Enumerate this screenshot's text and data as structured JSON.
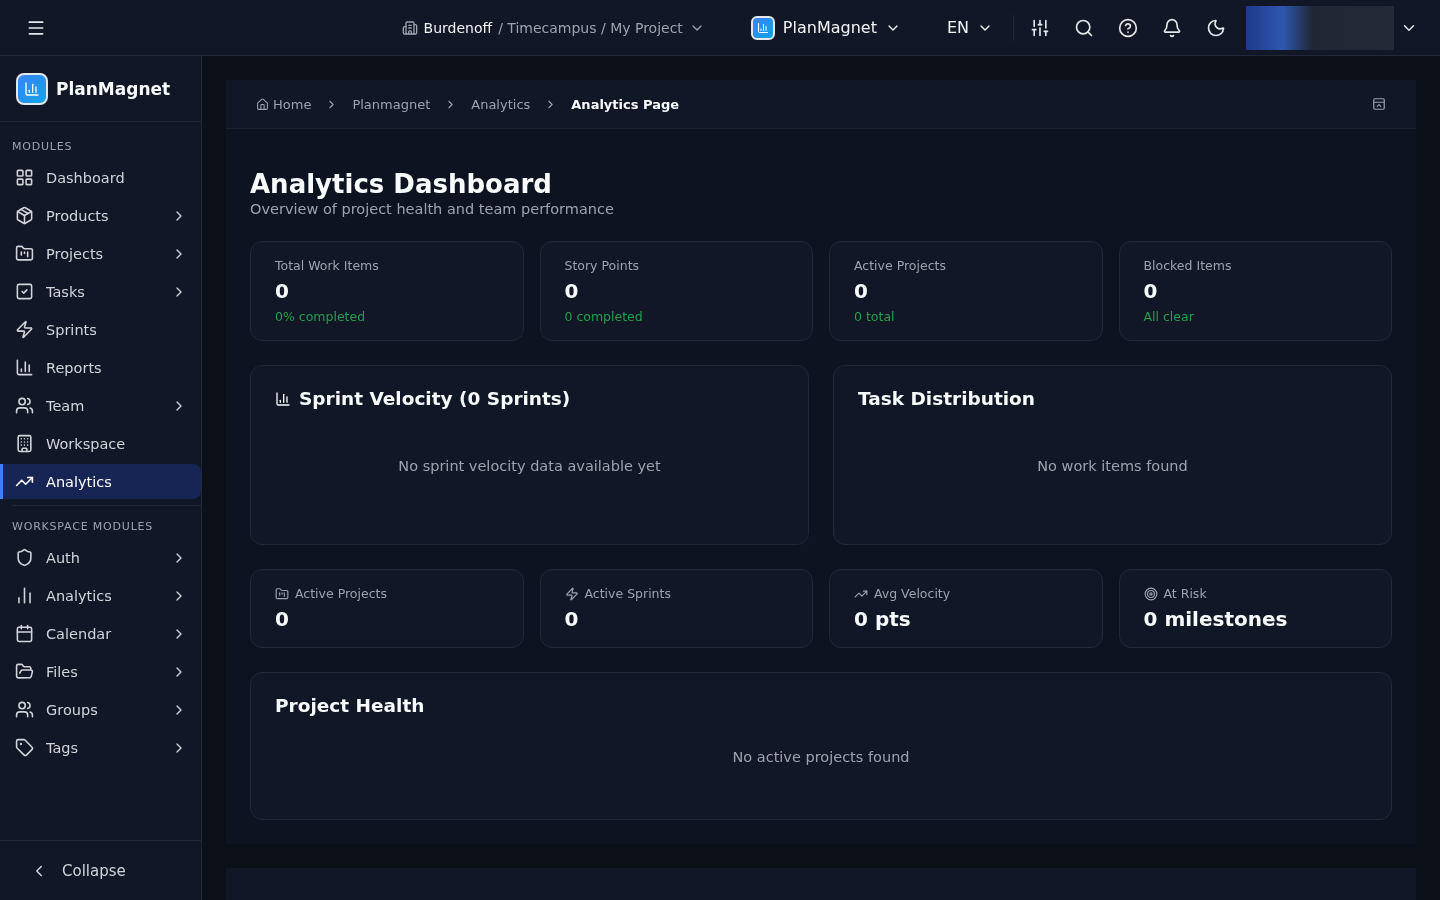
{
  "topbar": {
    "org": "Burdenoff",
    "path": "/ Timecampus / My Project",
    "app": "PlanMagnet",
    "language": "EN"
  },
  "sidebar": {
    "brand": "PlanMagnet",
    "sections": [
      {
        "title": "MODULES",
        "items": [
          {
            "label": "Dashboard",
            "expandable": false,
            "selected": false
          },
          {
            "label": "Products",
            "expandable": true,
            "selected": false
          },
          {
            "label": "Projects",
            "expandable": true,
            "selected": false
          },
          {
            "label": "Tasks",
            "expandable": true,
            "selected": false
          },
          {
            "label": "Sprints",
            "expandable": false,
            "selected": false
          },
          {
            "label": "Reports",
            "expandable": false,
            "selected": false
          },
          {
            "label": "Team",
            "expandable": true,
            "selected": false
          },
          {
            "label": "Workspace",
            "expandable": false,
            "selected": false
          },
          {
            "label": "Analytics",
            "expandable": false,
            "selected": true
          }
        ]
      },
      {
        "title": "WORKSPACE MODULES",
        "items": [
          {
            "label": "Auth",
            "expandable": true,
            "selected": false
          },
          {
            "label": "Analytics",
            "expandable": true,
            "selected": false
          },
          {
            "label": "Calendar",
            "expandable": true,
            "selected": false
          },
          {
            "label": "Files",
            "expandable": true,
            "selected": false
          },
          {
            "label": "Groups",
            "expandable": true,
            "selected": false
          },
          {
            "label": "Tags",
            "expandable": true,
            "selected": false
          }
        ]
      }
    ],
    "collapse": "Collapse"
  },
  "breadcrumb": [
    "Home",
    "Planmagnet",
    "Analytics",
    "Analytics Page"
  ],
  "page": {
    "title": "Analytics Dashboard",
    "subtitle": "Overview of project health and team performance"
  },
  "stats": [
    {
      "label": "Total Work Items",
      "value": "0",
      "note": "0% completed"
    },
    {
      "label": "Story Points",
      "value": "0",
      "note": "0 completed"
    },
    {
      "label": "Active Projects",
      "value": "0",
      "note": "0 total"
    },
    {
      "label": "Blocked Items",
      "value": "0",
      "note": "All clear"
    }
  ],
  "panels": [
    {
      "title": "Sprint Velocity (0 Sprints)",
      "icon": true,
      "empty": "No sprint velocity data available yet"
    },
    {
      "title": "Task Distribution",
      "icon": false,
      "empty": "No work items found"
    }
  ],
  "metrics": [
    {
      "label": "Active Projects",
      "value": "0"
    },
    {
      "label": "Active Sprints",
      "value": "0"
    },
    {
      "label": "Avg Velocity",
      "value": "0 pts"
    },
    {
      "label": "At Risk",
      "value": "0 milestones"
    }
  ],
  "health": {
    "title": "Project Health",
    "empty": "No active projects found"
  }
}
